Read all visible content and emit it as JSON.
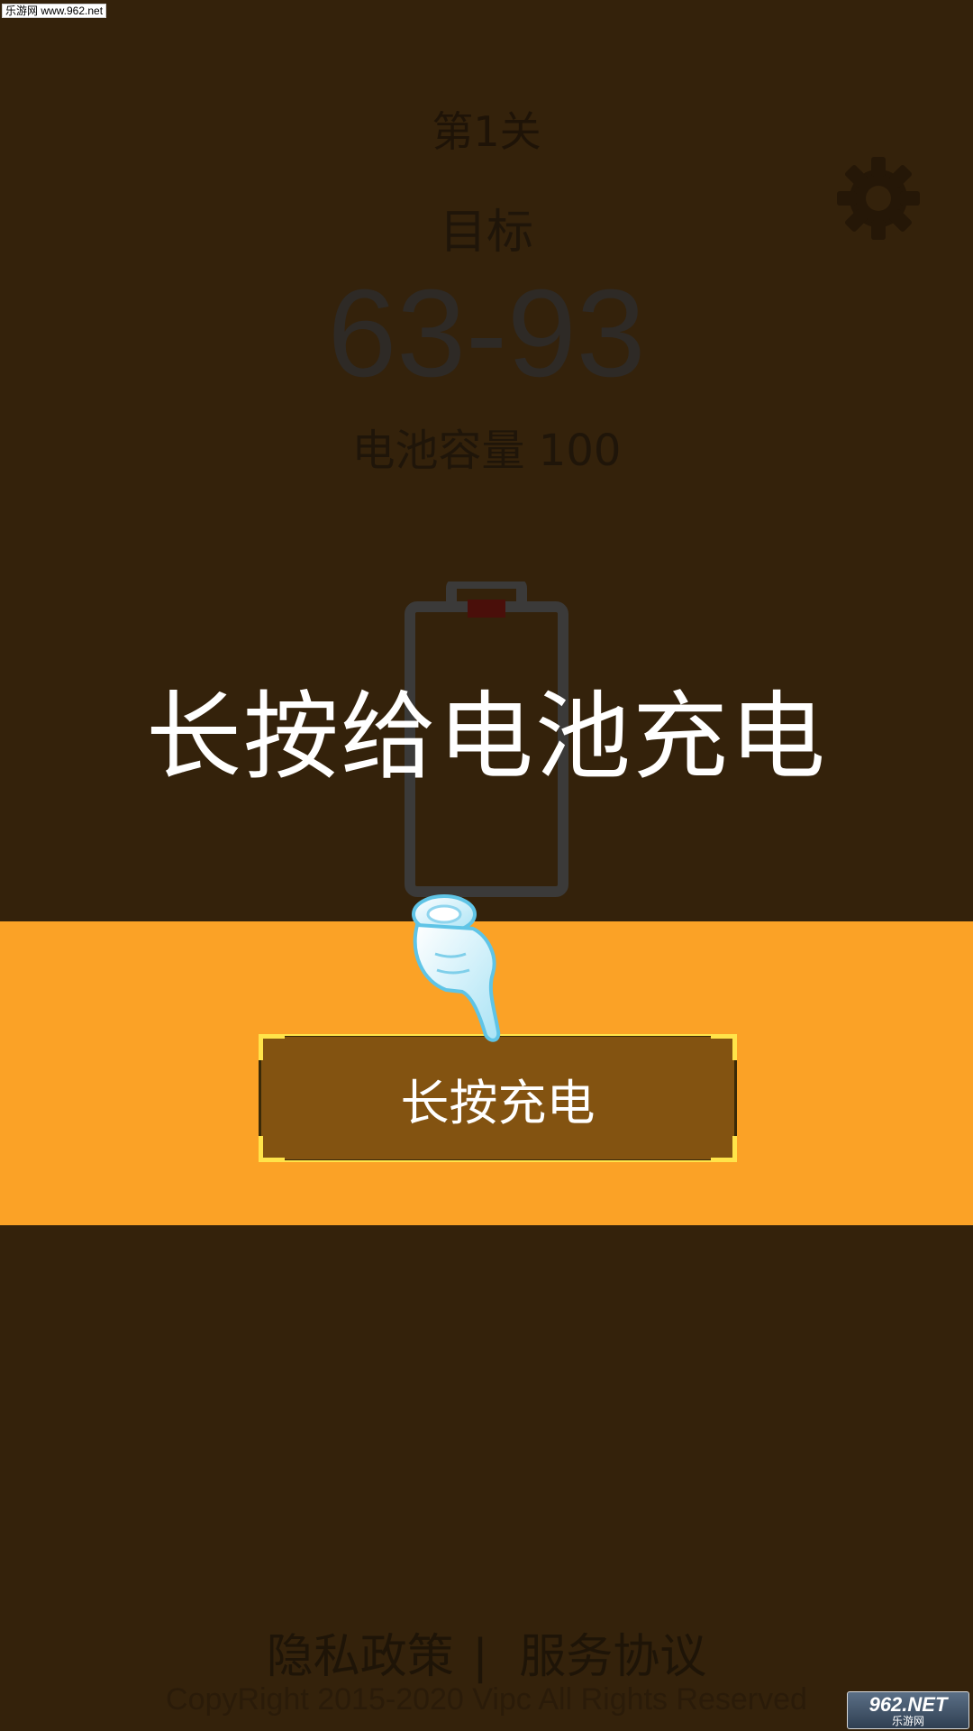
{
  "watermark": "乐游网 www.962.net",
  "header": {
    "level": "第1关",
    "target_label": "目标",
    "target_range": "63-93",
    "capacity": "电池容量 100"
  },
  "battery": {
    "charge_level": 0.05,
    "outline_color": "#3b3a39",
    "charge_color": "#4a0f0a"
  },
  "overlay": {
    "prompt": "长按给电池充电",
    "band_color": "#fba226"
  },
  "button": {
    "label": "长按充电"
  },
  "icons": {
    "settings": "gear-icon",
    "hand": "pointing-hand-icon"
  },
  "footer": {
    "privacy": "隐私政策",
    "separator": "|",
    "terms": "服务协议",
    "copyright": "CopyRight 2015-2020 Vipc All Rights Reserved"
  },
  "logo": {
    "line1": "962.NET",
    "line2": "乐游网"
  }
}
